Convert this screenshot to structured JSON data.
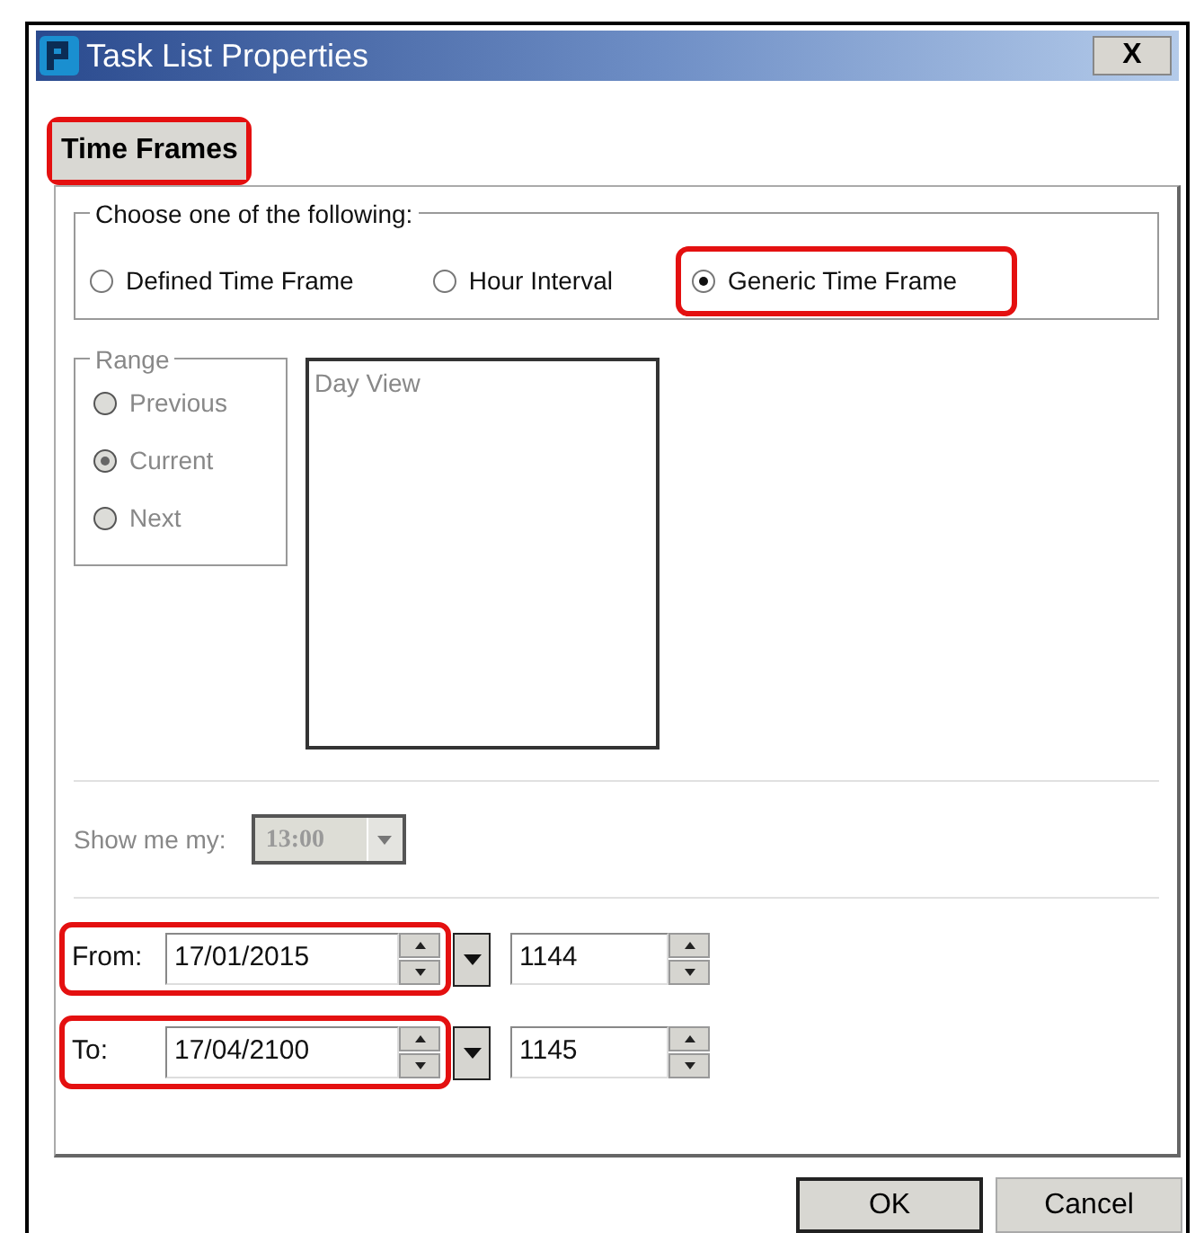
{
  "window": {
    "title": "Task List Properties",
    "close_label": "X"
  },
  "tabs": [
    {
      "label": "Time Frames",
      "selected": true,
      "highlighted": true
    }
  ],
  "choice_group": {
    "legend": "Choose one of the following:",
    "options": [
      {
        "label": "Defined Time Frame",
        "selected": false,
        "highlighted": false
      },
      {
        "label": "Hour Interval",
        "selected": false,
        "highlighted": false
      },
      {
        "label": "Generic Time Frame",
        "selected": true,
        "highlighted": true
      }
    ]
  },
  "range_group": {
    "legend": "Range",
    "disabled": true,
    "options": [
      {
        "label": "Previous",
        "selected": false
      },
      {
        "label": "Current",
        "selected": true
      },
      {
        "label": "Next",
        "selected": false
      }
    ]
  },
  "day_view": {
    "label": "Day View",
    "disabled": true
  },
  "show_me": {
    "label": "Show me my:",
    "value": "13:00",
    "disabled": true
  },
  "date_rows": [
    {
      "label": "From:",
      "date": "17/01/2015",
      "time": "1144",
      "highlighted": true
    },
    {
      "label": "To:",
      "date": "17/04/2100",
      "time": "1145",
      "highlighted": true
    }
  ],
  "buttons": [
    {
      "label": "OK",
      "default": true
    },
    {
      "label": "Cancel",
      "default": false
    }
  ]
}
